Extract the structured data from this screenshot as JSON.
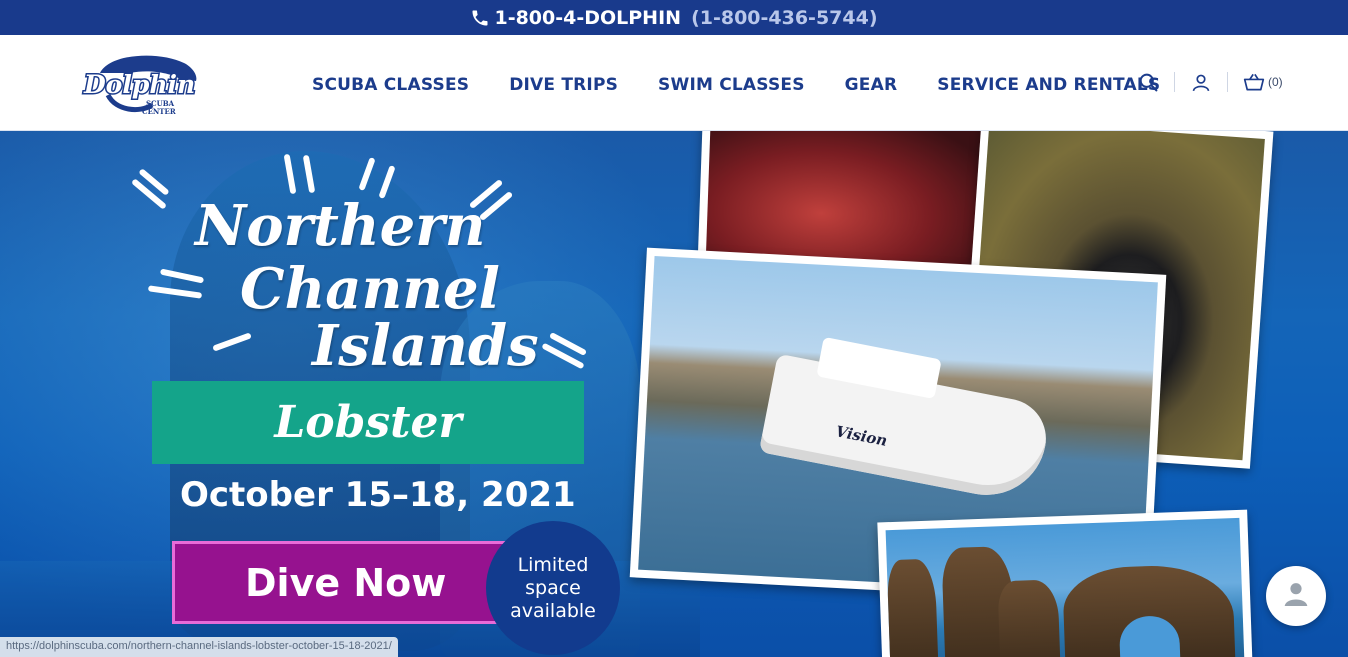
{
  "topbar": {
    "phone_primary": "1-800-4-DOLPHIN",
    "phone_alt": "(1-800-436-5744)",
    "icon": "phone-icon"
  },
  "header": {
    "logo": {
      "word": "Dolphin",
      "sub": "SCUBA CENTER"
    },
    "nav": [
      "SCUBA CLASSES",
      "DIVE TRIPS",
      "SWIM CLASSES",
      "GEAR",
      "SERVICE AND RENTALS"
    ],
    "tools": {
      "search_icon": "search-icon",
      "account_icon": "user-icon",
      "cart_icon": "basket-icon",
      "cart_count": "(0)"
    }
  },
  "hero": {
    "title_line1": "Northern",
    "title_line2": "Channel",
    "title_line3": "Islands",
    "subtitle": "Lobster",
    "dates": "October 15–18, 2021",
    "cta": "Dive Now",
    "badge": "Limited space available",
    "boat_name": "Vision"
  },
  "status_url": "https://dolphinscuba.com/northern-channel-islands-lobster-october-15-18-2021/",
  "chat": {
    "icon": "person-icon"
  },
  "colors": {
    "topbar": "#193a8c",
    "nav_text": "#1c3c8c",
    "band_green": "#14a48a",
    "cta_purple": "#96128f",
    "badge_navy": "#123b8e"
  }
}
